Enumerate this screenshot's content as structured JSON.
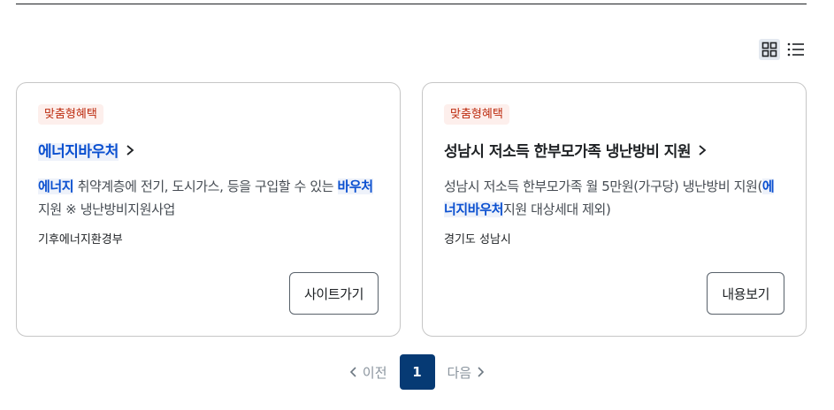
{
  "view_toggle": {
    "grid_icon": "grid-icon",
    "list_icon": "list-icon",
    "active": "grid"
  },
  "cards": [
    {
      "badge": "맞춤형혜택",
      "title_hl": "에너지바우처",
      "title_rest": "",
      "desc": [
        {
          "t": "에너지",
          "hl": true
        },
        {
          "t": " 취약계층에 전기, 도시가스, 등을 구입할 수 있는 ",
          "hl": false
        },
        {
          "t": "바우처",
          "hl": true
        },
        {
          "t": " 지원 ※ 냉난방비지원사업",
          "hl": false
        }
      ],
      "org": "기후에너지환경부",
      "button": "사이트가기"
    },
    {
      "badge": "맞춤형혜택",
      "title_hl": "",
      "title_rest": "성남시 저소득 한부모가족 냉난방비 지원",
      "desc": [
        {
          "t": "성남시 저소득 한부모가족 월 5만원(가구당) 냉난방비 지원(",
          "hl": false
        },
        {
          "t": "에너지바우처",
          "hl": true
        },
        {
          "t": "지원 대상세대 제외)",
          "hl": false
        }
      ],
      "org": "경기도 성남시",
      "button": "내용보기"
    }
  ],
  "pager": {
    "prev": "이전",
    "current": "1",
    "next": "다음"
  },
  "colors": {
    "accent": "#063a74",
    "highlight": "#0b50d0",
    "badge": "#bd2c0f"
  }
}
